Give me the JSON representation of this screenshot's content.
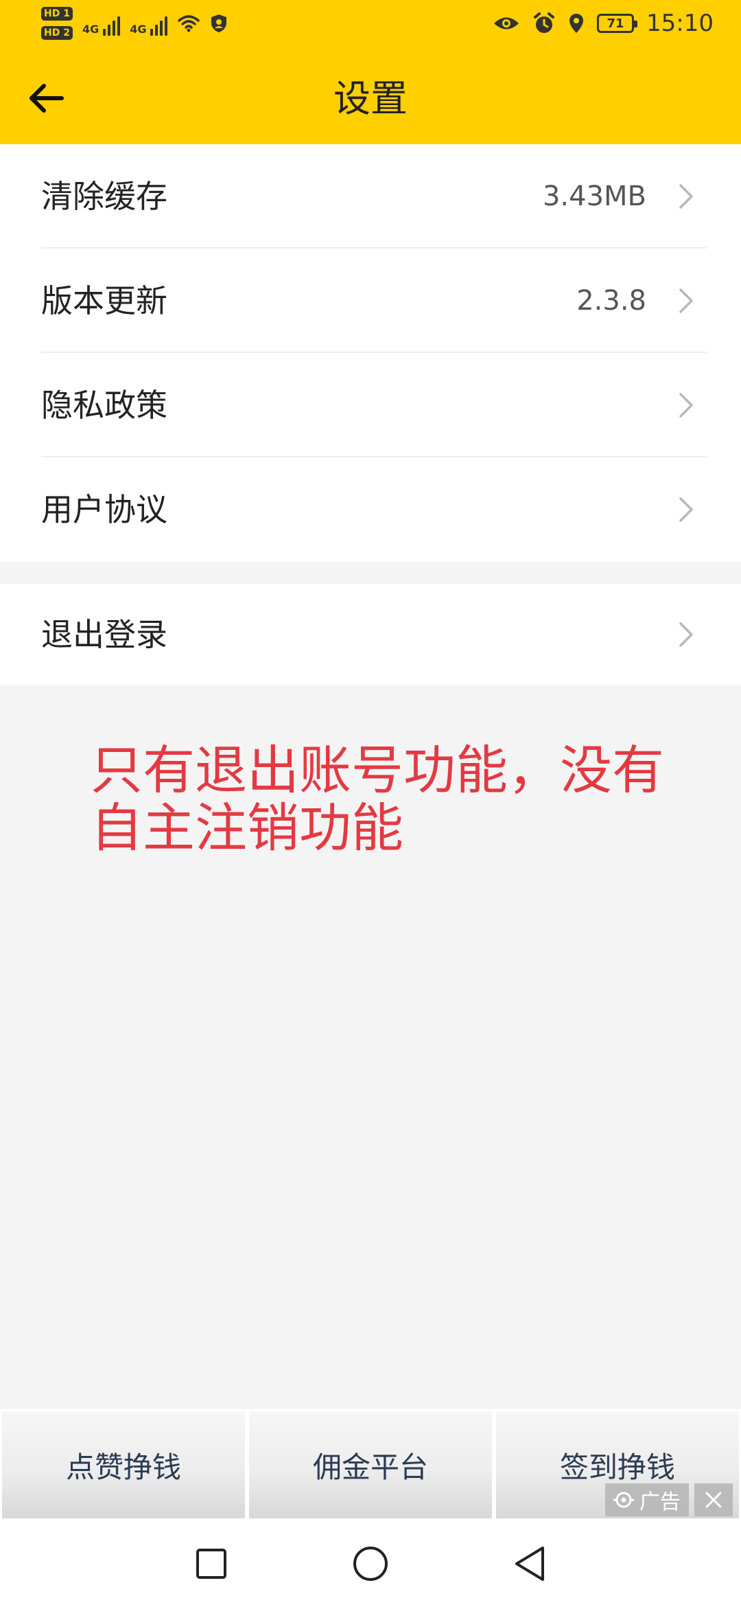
{
  "status_bar": {
    "hd1": "HD 1",
    "hd2": "HD 2",
    "net1": "4G",
    "net2": "4G",
    "battery": "71",
    "time": "15:10",
    "icons": [
      "eye-icon",
      "alarm-icon",
      "location-icon",
      "wifi-icon",
      "shield-icon"
    ]
  },
  "header": {
    "title": "设置",
    "back_icon": "arrow-left-icon"
  },
  "settings": {
    "items": [
      {
        "label": "清除缓存",
        "value": "3.43MB"
      },
      {
        "label": "版本更新",
        "value": "2.3.8"
      },
      {
        "label": "隐私政策",
        "value": ""
      },
      {
        "label": "用户协议",
        "value": ""
      }
    ],
    "logout": {
      "label": "退出登录"
    }
  },
  "annotation": {
    "text": "只有退出账号功能，没有自主注销功能"
  },
  "bottom_tabs": [
    {
      "label": "点赞挣钱"
    },
    {
      "label": "佣金平台"
    },
    {
      "label": "签到挣钱"
    }
  ],
  "ad": {
    "label": "广告"
  },
  "colors": {
    "header_bg": "#ffcf00",
    "annotation": "#e33a42",
    "page_bg": "#f4f4f4"
  }
}
